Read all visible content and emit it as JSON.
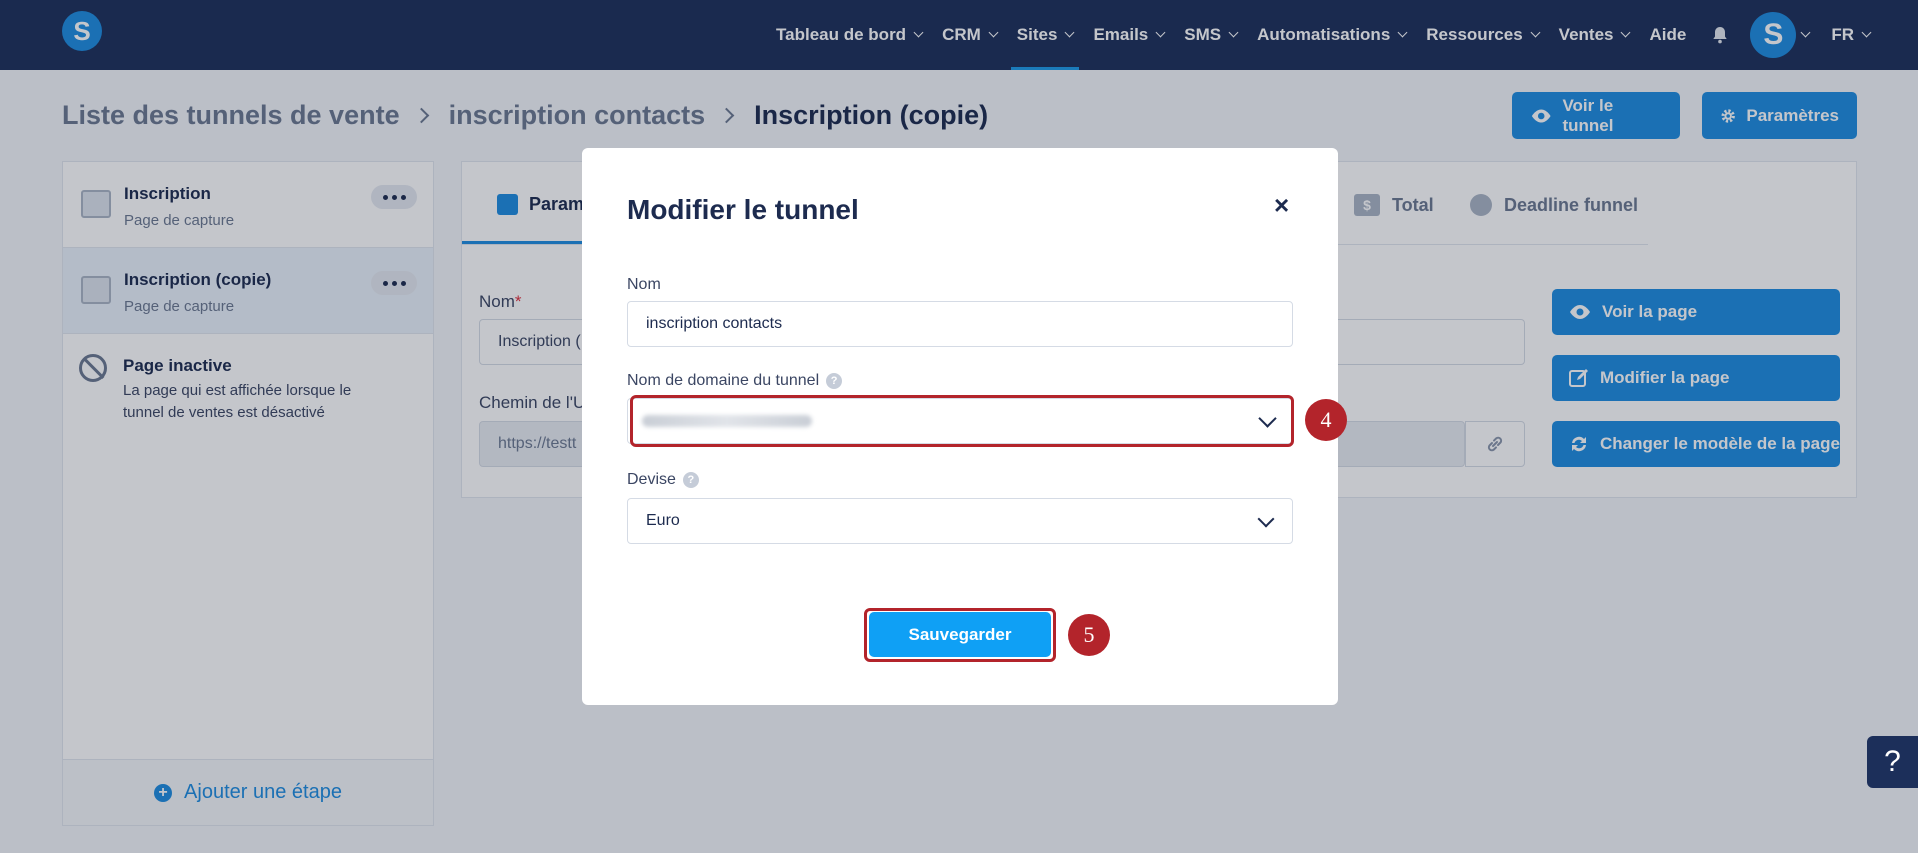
{
  "topbar": {
    "logo_letter": "S",
    "nav": [
      {
        "label": "Tableau de bord"
      },
      {
        "label": "CRM"
      },
      {
        "label": "Sites",
        "active": true
      },
      {
        "label": "Emails"
      },
      {
        "label": "SMS"
      },
      {
        "label": "Automatisations"
      },
      {
        "label": "Ressources"
      },
      {
        "label": "Ventes"
      },
      {
        "label": "Aide"
      }
    ],
    "avatar_letter": "S",
    "language": "FR"
  },
  "header": {
    "breadcrumb": [
      "Liste des tunnels de vente",
      "inscription contacts",
      "Inscription (copie)"
    ],
    "view_funnel_label": "Voir le tunnel",
    "settings_label": "Paramètres"
  },
  "steps": [
    {
      "title": "Inscription",
      "subtitle": "Page de capture"
    },
    {
      "title": "Inscription (copie)",
      "subtitle": "Page de capture",
      "selected": true
    }
  ],
  "inactive_page": {
    "title": "Page inactive",
    "description": "La page qui est affichée lorsque le tunnel de ventes est désactivé"
  },
  "add_step_label": "Ajouter une étape",
  "main": {
    "tabs": [
      {
        "label": "Param",
        "active": true
      },
      {
        "label": "Total",
        "icon_text": "$"
      },
      {
        "label": "Deadline funnel"
      }
    ],
    "name_label": "Nom",
    "name_value": "Inscription (",
    "url_label": "Chemin de l'U",
    "url_value": "https://testt",
    "actions": [
      "Voir la page",
      "Modifier la page",
      "Changer le modèle de la page"
    ]
  },
  "modal": {
    "title": "Modifier le tunnel",
    "close": "×",
    "name_label": "Nom",
    "name_value": "inscription contacts",
    "domain_label": "Nom de domaine du tunnel",
    "currency_label": "Devise",
    "currency_value": "Euro",
    "help_glyph": "?",
    "save_label": "Sauvegarder"
  },
  "annotations": {
    "domain_badge": "4",
    "save_badge": "5"
  },
  "help_fab": "?",
  "colors": {
    "nav_bg": "#1c2f5a",
    "primary": "#1e8de0",
    "highlight": "#b3242b"
  }
}
